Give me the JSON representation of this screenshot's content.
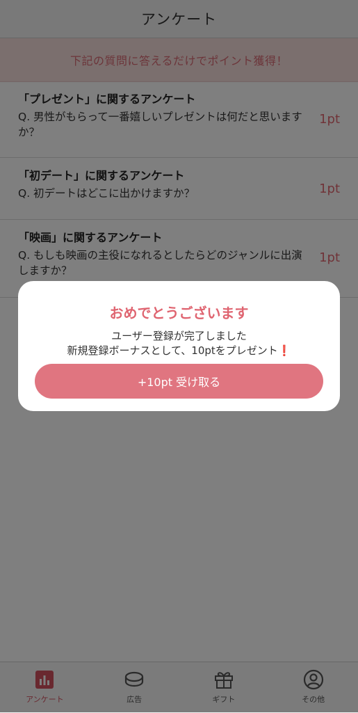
{
  "header": {
    "title": "アンケート"
  },
  "banner": {
    "text": "下記の質問に答えるだけでポイント獲得！"
  },
  "surveys": [
    {
      "title": "「プレゼント」に関するアンケート",
      "question": "Q. 男性がもらって一番嬉しいプレゼントは何だと思いますか？",
      "points": "1pt"
    },
    {
      "title": "「初デート」に関するアンケート",
      "question": "Q. 初デートはどこに出かけますか？",
      "points": "1pt"
    },
    {
      "title": "「映画」に関するアンケート",
      "question": "Q. もしも映画の主役になれるとしたらどのジャンルに出演しますか？",
      "points": "1pt"
    }
  ],
  "modal": {
    "title": "おめでとうございます",
    "message_line1": "ユーザー登録が完了しました",
    "message_line2": "新規登録ボーナスとして、10ptをプレゼント",
    "exclamation": "❗",
    "button_label": "+10pt 受け取る"
  },
  "tabbar": {
    "tabs": [
      {
        "label": "アンケート",
        "icon": "chart-icon",
        "active": true
      },
      {
        "label": "広告",
        "icon": "coin-icon",
        "active": false
      },
      {
        "label": "ギフト",
        "icon": "gift-icon",
        "active": false
      },
      {
        "label": "その他",
        "icon": "user-icon",
        "active": false
      }
    ]
  },
  "colors": {
    "accent": "#e07580",
    "active_tab": "#d2505e",
    "banner_bg": "#f6dedd"
  }
}
